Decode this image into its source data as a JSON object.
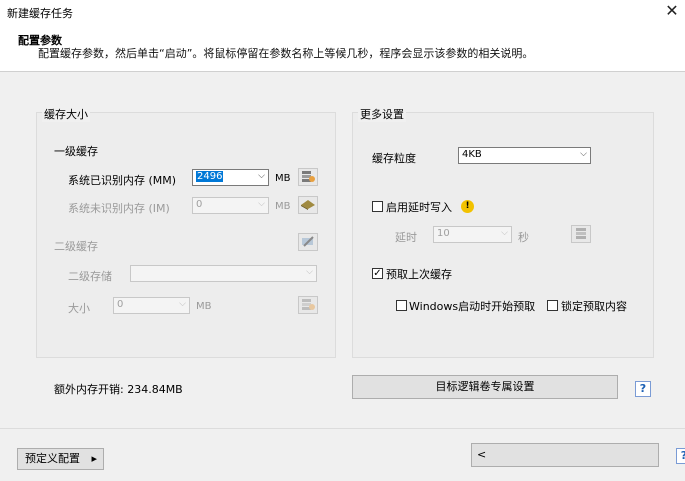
{
  "window": {
    "title": "新建缓存任务",
    "close_glyph": "✕"
  },
  "header": {
    "title": "配置参数",
    "description": "配置缓存参数，然后单击“启动”。将鼠标停留在参数名称上等候几秒，程序会显示该参数的相关说明。"
  },
  "cache_size": {
    "group_label": "缓存大小",
    "level1": {
      "label": "一级缓存",
      "recognized": {
        "label": "系统已识别内存 (MM)",
        "value": "2496",
        "unit": "MB"
      },
      "unrecognized": {
        "label": "系统未识别内存 (IM)",
        "value": "0",
        "unit": "MB"
      }
    },
    "level2": {
      "label": "二级缓存",
      "storage": {
        "label": "二级存储",
        "value": ""
      },
      "size": {
        "label": "大小",
        "value": "0",
        "unit": "MB"
      }
    }
  },
  "more_settings": {
    "group_label": "更多设置",
    "granularity": {
      "label": "缓存粒度",
      "value": "4KB"
    },
    "delayed_write": {
      "label": "启用延时写入",
      "checked": false
    },
    "delay": {
      "label": "延时",
      "value": "10",
      "unit": "秒"
    },
    "prefetch_last": {
      "label": "预取上次缓存",
      "checked": true
    },
    "prefetch_on_start": {
      "label": "Windows启动时开始预取",
      "checked": false
    },
    "lock_prefetch": {
      "label": "锁定预取内容",
      "checked": false
    }
  },
  "extra_memory": "额外内存开销: 234.84MB",
  "target_volume_button": "目标逻辑卷专属设置",
  "help_glyph": "?",
  "footer": {
    "preset_button": "预定义配置",
    "preset_arrow": "▸",
    "back_button": "<"
  },
  "icons": {
    "arrow_down": "⌵",
    "check": "✓",
    "warning": "!"
  }
}
